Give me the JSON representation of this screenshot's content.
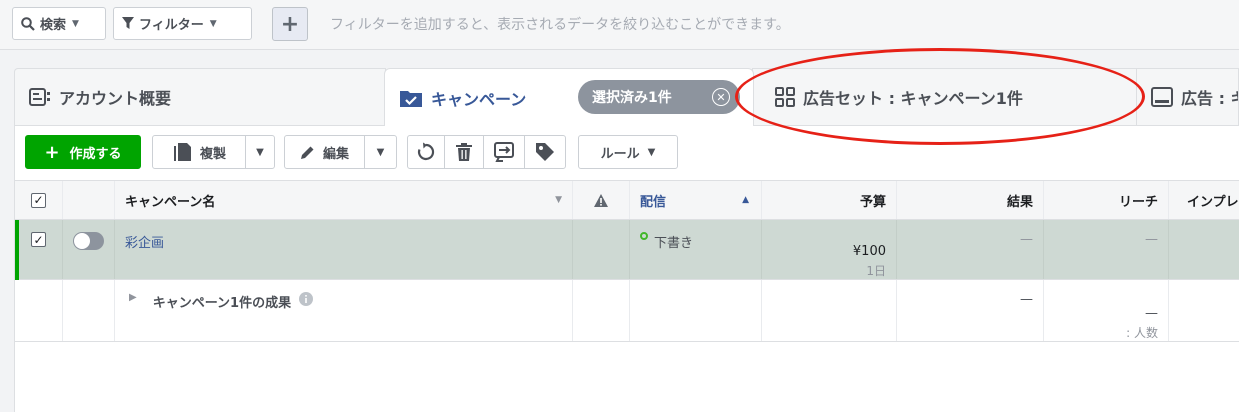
{
  "filterbar": {
    "search_label": "検索",
    "filter_label": "フィルター",
    "hint": "フィルターを追加すると、表示されるデータを絞り込むことができます。"
  },
  "tabs": {
    "account": "アカウント概要",
    "campaign": "キャンペーン",
    "selected_badge": "選択済み1件",
    "adset": "広告セット : キャンペーン1件",
    "ad": "広告 : キ"
  },
  "toolbar": {
    "create": "作成する",
    "duplicate": "複製",
    "edit": "編集",
    "rules": "ルール"
  },
  "table": {
    "headers": {
      "name": "キャンペーン名",
      "delivery": "配信",
      "budget": "予算",
      "results": "結果",
      "reach": "リーチ",
      "impressions": "インプレ"
    },
    "row": {
      "name": "彩企画",
      "delivery": "下書き",
      "budget": "¥100",
      "budget_period": "1日",
      "results": "—",
      "reach": "—"
    },
    "summary": {
      "label": "キャンペーン1件の成果",
      "results": "—",
      "reach": "—",
      "reach_unit": ": 人数"
    }
  },
  "colors": {
    "accent": "#385898",
    "create_button": "#00a400",
    "selected_row": "#ced9d3",
    "annotation": "#e62117"
  }
}
